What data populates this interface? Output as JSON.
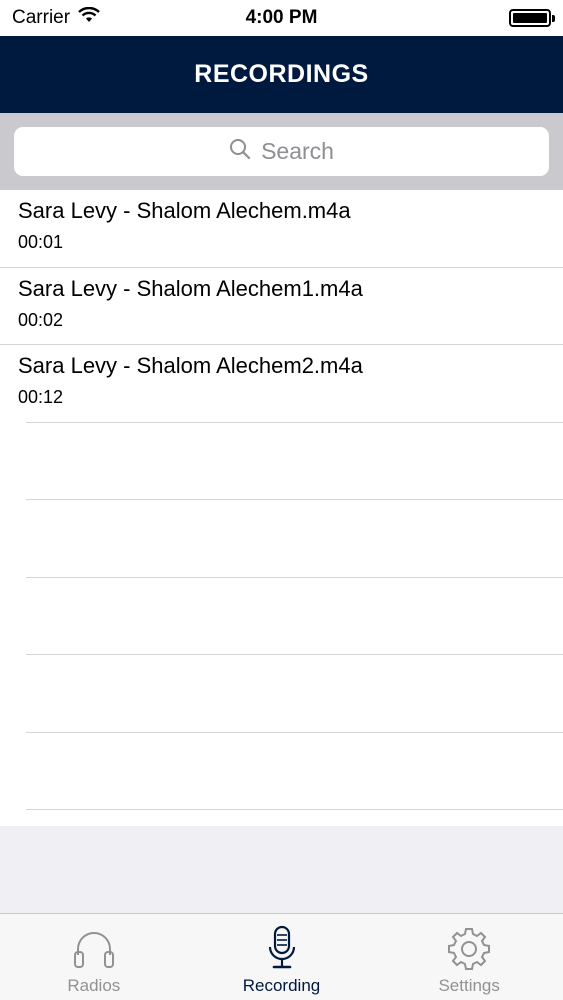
{
  "status_bar": {
    "carrier": "Carrier",
    "time": "4:00 PM"
  },
  "nav": {
    "title": "RECORDINGS"
  },
  "search": {
    "placeholder": "Search"
  },
  "recordings": [
    {
      "title": "Sara Levy - Shalom Alechem.m4a",
      "duration": "00:01"
    },
    {
      "title": "Sara Levy - Shalom Alechem1.m4a",
      "duration": "00:02"
    },
    {
      "title": "Sara Levy - Shalom Alechem2.m4a",
      "duration": "00:12"
    }
  ],
  "tabs": [
    {
      "label": "Radios",
      "icon": "headphones-icon",
      "active": false
    },
    {
      "label": "Recording",
      "icon": "microphone-icon",
      "active": true
    },
    {
      "label": "Settings",
      "icon": "gear-icon",
      "active": false
    }
  ],
  "colors": {
    "nav_bg": "#001a3f",
    "active_tab": "#001a3f",
    "inactive_tab": "#929292"
  }
}
